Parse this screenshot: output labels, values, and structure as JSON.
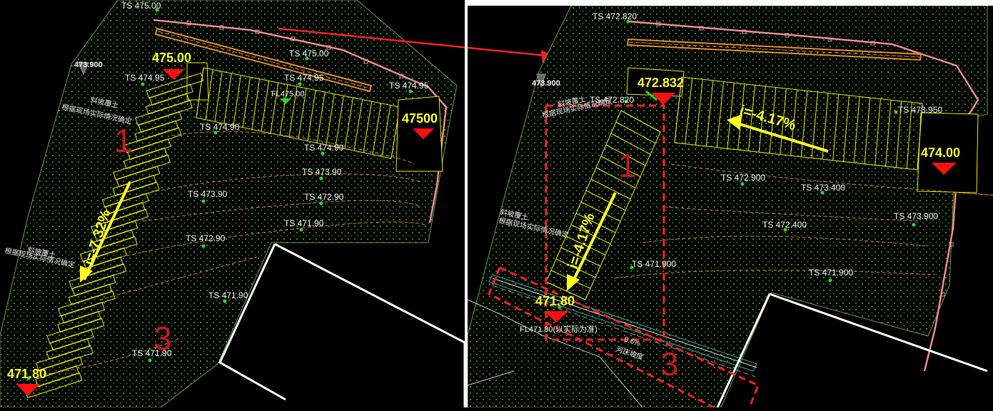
{
  "colors": {
    "background": "#000000",
    "site_dots": "#3fae2a",
    "boundary": "#e98a8a",
    "steps": "#e6e600",
    "contour": "#c97b2d",
    "arrow_yellow": "#ffff22",
    "arrow_red": "#ff2020",
    "marker_red": "#ff1010",
    "zone_number": "#c41a1a",
    "building_outline": "#ffffff"
  },
  "left_plan": {
    "levels": {
      "top_spot": "475.00",
      "right_spot": "47500",
      "bottom_spot": "471.80",
      "corner_spot": "473.900"
    },
    "ts_labels": {
      "t1": "TS 475.00",
      "t2": "TS 475.00",
      "t3": "TS 474.95",
      "t4": "TS 474.95",
      "t5": "TS 474.95",
      "t6": "TS 474.90",
      "t7": "TS 474.90",
      "t8": "TS 473.90",
      "t9": "TS 473.90",
      "t10": "TS 472.90",
      "t11": "TS 472.90",
      "t12": "TS 471.90",
      "t13": "TS 471.90",
      "t14": "TS 471.90"
    },
    "fl_label": "FL475.00",
    "slope_label": "i=-7.32%",
    "zone_1": "1",
    "zone_3": "3",
    "note_1": "斜坡覆土",
    "note_2": "根据现场实际情况确定"
  },
  "right_plan": {
    "levels": {
      "top_spot": "472.832",
      "right_spot": "474.00",
      "bottom_spot": "471.80",
      "corner_spot": "473.900"
    },
    "ts_labels": {
      "t1": "TS 472.820",
      "t2": "TS 472.820",
      "t3": "TS 473.950",
      "t4": "TS 472.900",
      "t5": "TS 473.400",
      "t6": "TS 473.900",
      "t7": "TS 472.400",
      "t8": "TS 471.900",
      "t9": "TS 471.900"
    },
    "fl_label": "FL471.80(以实际为准)",
    "slope_top": "i=-4.17%",
    "slope_left": "i=-4.17%",
    "zone_1": "1",
    "zone_3": "3",
    "note_1": "斜坡覆土",
    "note_2": "根据现场实际情况确定",
    "small_slope": "0.6%",
    "drain_note": "河床坡度"
  }
}
